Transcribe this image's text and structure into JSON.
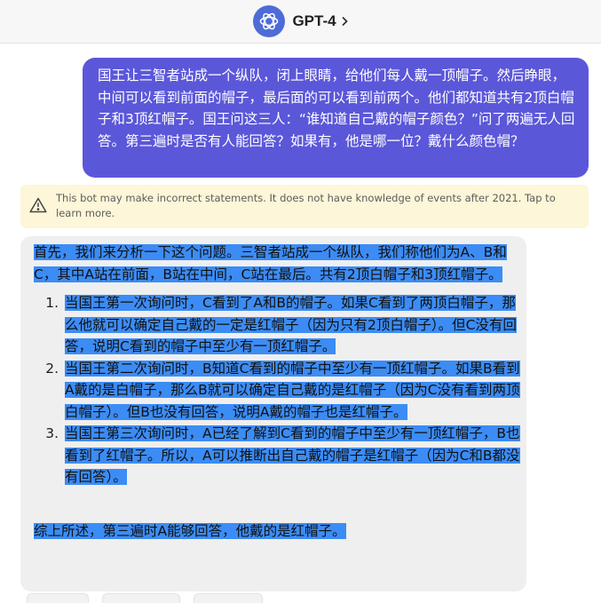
{
  "header": {
    "title": "GPT-4"
  },
  "user_message": "国王让三智者站成一个纵队，闭上眼睛，给他们每人戴一顶帽子。然后睁眼，中间可以看到前面的帽子，最后面的可以看到前两个。他们都知道共有2顶白帽子和3顶红帽子。国王问这三人：“谁知道自己戴的帽子颜色？”问了两遍无人回答。第三遍时是否有人能回答？如果有，他是哪一位？戴什么颜色帽？",
  "notice": {
    "text": "This bot may make incorrect statements. It does not have knowledge of events after 2021. Tap to learn more."
  },
  "bot_message": {
    "intro": "首先，我们来分析一下这个问题。三智者站成一个纵队，我们称他们为A、B和C，其中A站在前面，B站在中间，C站在最后。共有2顶白帽子和3顶红帽子。",
    "steps": [
      "当国王第一次询问时，C看到了A和B的帽子。如果C看到了两顶白帽子，那么他就可以确定自己戴的一定是红帽子（因为只有2顶白帽子）。但C没有回答，说明C看到的帽子中至少有一顶红帽子。",
      "当国王第二次询问时，B知道C看到的帽子中至少有一顶红帽子。如果B看到A戴的是白帽子，那么B就可以确定自己戴的是红帽子（因为C没有看到两顶白帽子）。但B也没有回答，说明A戴的帽子也是红帽子。",
      "当国王第三次询问时，A已经了解到C看到的帽子中至少有一顶红帽子，B也看到了红帽子。所以，A可以推断出自己戴的帽子是红帽子（因为C和B都没有回答）。"
    ],
    "summary": "综上所述，第三遍时A能够回答，他戴的是红帽子。"
  },
  "colors": {
    "user_bubble": "#5b57d9",
    "bot_bubble": "#efefef",
    "selection_highlight": "#3c8cf5",
    "notice_bg": "#fdf6d8",
    "logo_bg": "#4f6bd8"
  },
  "icons": {
    "logo": "openai-logo-icon",
    "chevron": "chevron-right-icon",
    "warning": "warning-triangle-icon"
  }
}
